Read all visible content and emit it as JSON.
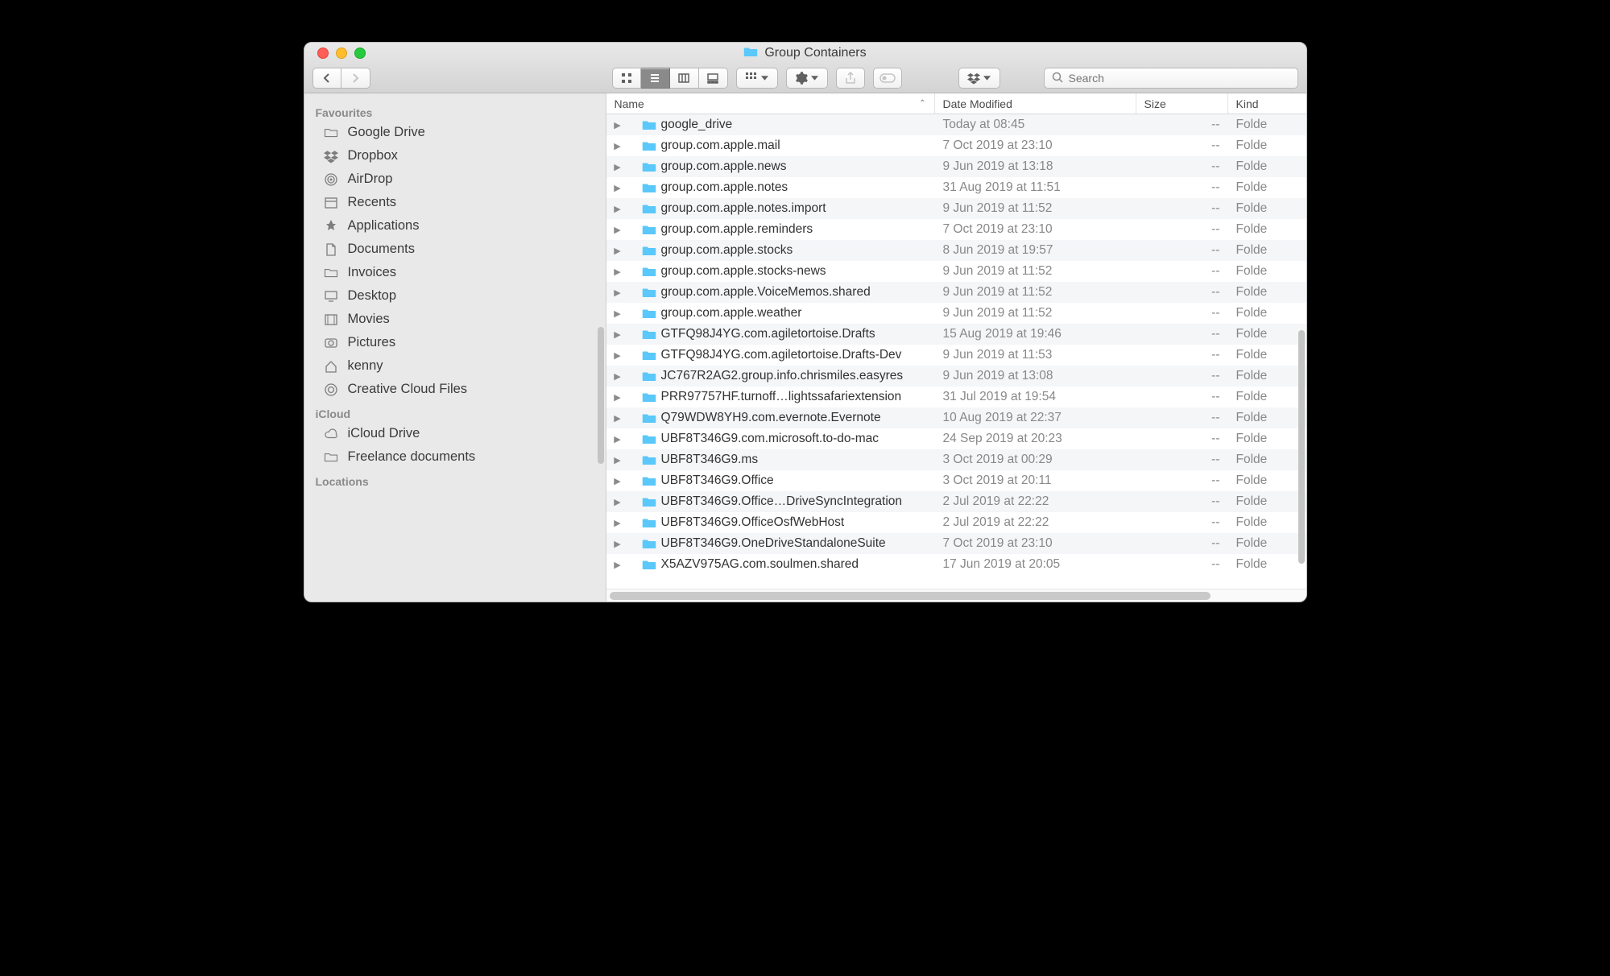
{
  "window": {
    "title": "Group Containers"
  },
  "toolbar": {
    "search_placeholder": "Search"
  },
  "sidebar": {
    "sections": [
      {
        "title": "Favourites",
        "items": [
          {
            "icon": "folder",
            "label": "Google Drive"
          },
          {
            "icon": "dropbox",
            "label": "Dropbox"
          },
          {
            "icon": "airdrop",
            "label": "AirDrop"
          },
          {
            "icon": "recents",
            "label": "Recents"
          },
          {
            "icon": "apps",
            "label": "Applications"
          },
          {
            "icon": "documents",
            "label": "Documents"
          },
          {
            "icon": "folder",
            "label": "Invoices"
          },
          {
            "icon": "desktop",
            "label": "Desktop"
          },
          {
            "icon": "movies",
            "label": "Movies"
          },
          {
            "icon": "pictures",
            "label": "Pictures"
          },
          {
            "icon": "home",
            "label": "kenny"
          },
          {
            "icon": "cc",
            "label": "Creative Cloud Files"
          }
        ]
      },
      {
        "title": "iCloud",
        "items": [
          {
            "icon": "cloud",
            "label": "iCloud Drive"
          },
          {
            "icon": "folder",
            "label": "Freelance documents"
          }
        ]
      },
      {
        "title": "Locations",
        "items": []
      }
    ]
  },
  "columns": {
    "name": "Name",
    "date": "Date Modified",
    "size": "Size",
    "kind": "Kind"
  },
  "files": [
    {
      "name": "google_drive",
      "date": "Today at 08:45",
      "size": "--",
      "kind": "Folde"
    },
    {
      "name": "group.com.apple.mail",
      "date": "7 Oct 2019 at 23:10",
      "size": "--",
      "kind": "Folde"
    },
    {
      "name": "group.com.apple.news",
      "date": "9 Jun 2019 at 13:18",
      "size": "--",
      "kind": "Folde"
    },
    {
      "name": "group.com.apple.notes",
      "date": "31 Aug 2019 at 11:51",
      "size": "--",
      "kind": "Folde"
    },
    {
      "name": "group.com.apple.notes.import",
      "date": "9 Jun 2019 at 11:52",
      "size": "--",
      "kind": "Folde"
    },
    {
      "name": "group.com.apple.reminders",
      "date": "7 Oct 2019 at 23:10",
      "size": "--",
      "kind": "Folde"
    },
    {
      "name": "group.com.apple.stocks",
      "date": "8 Jun 2019 at 19:57",
      "size": "--",
      "kind": "Folde"
    },
    {
      "name": "group.com.apple.stocks-news",
      "date": "9 Jun 2019 at 11:52",
      "size": "--",
      "kind": "Folde"
    },
    {
      "name": "group.com.apple.VoiceMemos.shared",
      "date": "9 Jun 2019 at 11:52",
      "size": "--",
      "kind": "Folde"
    },
    {
      "name": "group.com.apple.weather",
      "date": "9 Jun 2019 at 11:52",
      "size": "--",
      "kind": "Folde"
    },
    {
      "name": "GTFQ98J4YG.com.agiletortoise.Drafts",
      "date": "15 Aug 2019 at 19:46",
      "size": "--",
      "kind": "Folde"
    },
    {
      "name": "GTFQ98J4YG.com.agiletortoise.Drafts-Dev",
      "date": "9 Jun 2019 at 11:53",
      "size": "--",
      "kind": "Folde"
    },
    {
      "name": "JC767R2AG2.group.info.chrismiles.easyres",
      "date": "9 Jun 2019 at 13:08",
      "size": "--",
      "kind": "Folde"
    },
    {
      "name": "PRR97757HF.turnoff…lightssafariextension",
      "date": "31 Jul 2019 at 19:54",
      "size": "--",
      "kind": "Folde"
    },
    {
      "name": "Q79WDW8YH9.com.evernote.Evernote",
      "date": "10 Aug 2019 at 22:37",
      "size": "--",
      "kind": "Folde"
    },
    {
      "name": "UBF8T346G9.com.microsoft.to-do-mac",
      "date": "24 Sep 2019 at 20:23",
      "size": "--",
      "kind": "Folde"
    },
    {
      "name": "UBF8T346G9.ms",
      "date": "3 Oct 2019 at 00:29",
      "size": "--",
      "kind": "Folde"
    },
    {
      "name": "UBF8T346G9.Office",
      "date": "3 Oct 2019 at 20:11",
      "size": "--",
      "kind": "Folde"
    },
    {
      "name": "UBF8T346G9.Office…DriveSyncIntegration",
      "date": "2 Jul 2019 at 22:22",
      "size": "--",
      "kind": "Folde"
    },
    {
      "name": "UBF8T346G9.OfficeOsfWebHost",
      "date": "2 Jul 2019 at 22:22",
      "size": "--",
      "kind": "Folde"
    },
    {
      "name": "UBF8T346G9.OneDriveStandaloneSuite",
      "date": "7 Oct 2019 at 23:10",
      "size": "--",
      "kind": "Folde"
    },
    {
      "name": "X5AZV975AG.com.soulmen.shared",
      "date": "17 Jun 2019 at 20:05",
      "size": "--",
      "kind": "Folde"
    }
  ]
}
